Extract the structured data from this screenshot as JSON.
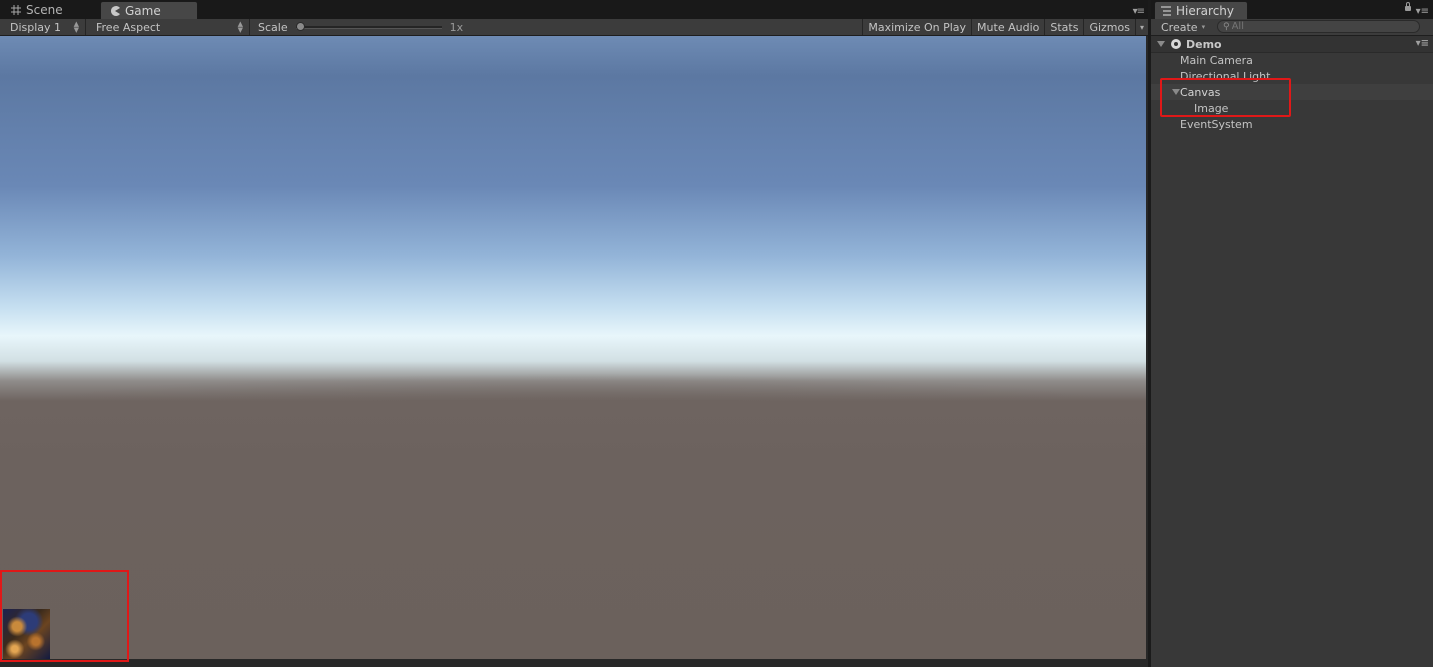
{
  "game_panel": {
    "tabs": [
      {
        "label": "Scene",
        "icon": "grid-icon",
        "active": false
      },
      {
        "label": "Game",
        "icon": "pacman-icon",
        "active": true
      }
    ],
    "toolbar": {
      "display": "Display 1",
      "aspect": "Free Aspect",
      "scale_label": "Scale",
      "scale_value": "1x",
      "scale_level": 0,
      "maximize_on_play": "Maximize On Play",
      "mute_audio": "Mute Audio",
      "stats": "Stats",
      "gizmos": "Gizmos"
    }
  },
  "hierarchy": {
    "tab_label": "Hierarchy",
    "create_label": "Create",
    "search_placeholder": "All",
    "scene_name": "Demo",
    "items": [
      {
        "label": "Main Camera",
        "depth": 0,
        "expanded": null,
        "selected": false
      },
      {
        "label": "Directional Light",
        "depth": 0,
        "expanded": null,
        "selected": false
      },
      {
        "label": "Canvas",
        "depth": 0,
        "expanded": true,
        "selected": true
      },
      {
        "label": "Image",
        "depth": 1,
        "expanded": null,
        "selected": false
      },
      {
        "label": "EventSystem",
        "depth": 0,
        "expanded": null,
        "selected": false
      }
    ]
  },
  "colors": {
    "highlight_box": "#e01818",
    "panel_bg": "#383838",
    "sky_top": "#5c78a2",
    "horizon": "#e8f6fb",
    "ground": "#6b615c"
  }
}
